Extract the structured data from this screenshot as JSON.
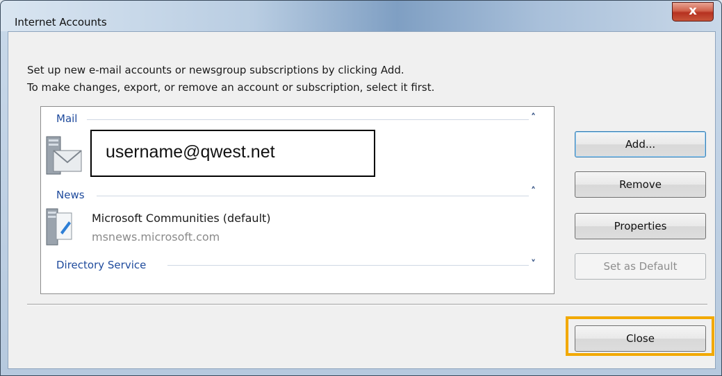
{
  "window": {
    "title": "Internet Accounts",
    "close_glyph": "x"
  },
  "instructions": {
    "line1": "Set up new e-mail accounts or newsgroup subscriptions by clicking Add.",
    "line2": "To make changes, export, or remove an account or subscription, select it first."
  },
  "groups": {
    "mail": {
      "label": "Mail",
      "chevron": "˄",
      "account": {
        "name": "username@qwest.net",
        "icon": "mail-account-icon"
      }
    },
    "news": {
      "label": "News",
      "chevron": "˄",
      "account": {
        "name": "Microsoft Communities (default)",
        "server": "msnews.microsoft.com",
        "icon": "news-account-icon"
      }
    },
    "directory": {
      "label": "Directory Service",
      "chevron": "˅"
    }
  },
  "buttons": {
    "add": "Add...",
    "remove": "Remove",
    "properties": "Properties",
    "set_default": "Set as Default",
    "close": "Close"
  },
  "colors": {
    "highlight": "#f2a900",
    "group_header": "#1e4a9c"
  }
}
